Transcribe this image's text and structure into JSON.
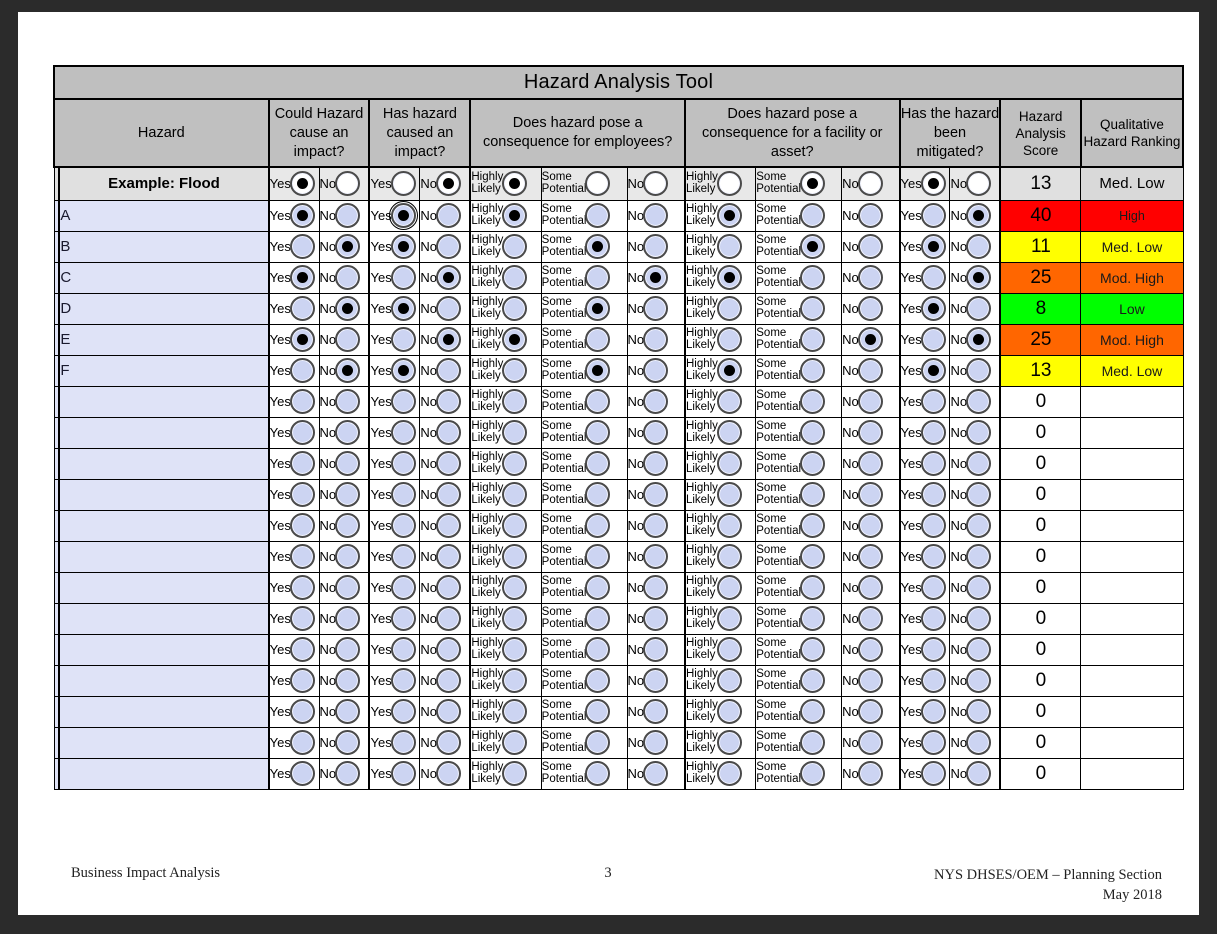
{
  "document": {
    "title": "Hazard Analysis Tool"
  },
  "columns": {
    "hazard": "Hazard",
    "could_cause": "Could Hazard cause an impact?",
    "has_caused": "Has hazard caused an impact?",
    "employees": "Does hazard pose a consequence for employees?",
    "facility": "Does hazard pose a consequence for a facility or asset?",
    "mitigated": "Has the hazard been mitigated?",
    "score": "Hazard Analysis Score",
    "ranking": "Qualitative Hazard Ranking"
  },
  "labels": {
    "yes": "Yes",
    "no": "No",
    "highly_likely": "Highly Likely",
    "some_potential": "Some Potential",
    "no_consequence": "No"
  },
  "colors": {
    "high": "#ff0000",
    "mod_high": "#ff6600",
    "med_low": "#ffff00",
    "low": "#00ff00",
    "header_gray": "#c0c0c0",
    "row_blue": "#dfe3f7",
    "example_gray": "#e0e0e0"
  },
  "rows": [
    {
      "name": "Example: Flood",
      "example": true,
      "could": "yes",
      "caused": "no",
      "employees": "highly",
      "facility": "some",
      "mitigated": "yes",
      "score": "13",
      "ranking": "Med. Low",
      "color": ""
    },
    {
      "name": "A",
      "example": false,
      "could": "yes",
      "caused": "yes",
      "employees": "highly",
      "facility": "highly",
      "mitigated": "no",
      "score": "40",
      "ranking": "High",
      "color": "#ff0000"
    },
    {
      "name": "B",
      "example": false,
      "could": "no",
      "caused": "yes",
      "employees": "some",
      "facility": "some",
      "mitigated": "yes",
      "score": "11",
      "ranking": "Med. Low",
      "color": "#ffff00"
    },
    {
      "name": "C",
      "example": false,
      "could": "yes",
      "caused": "no",
      "employees": "none",
      "facility": "highly",
      "mitigated": "no",
      "score": "25",
      "ranking": "Mod. High",
      "color": "#ff6600"
    },
    {
      "name": "D",
      "example": false,
      "could": "no",
      "caused": "yes",
      "employees": "some",
      "facility": "",
      "mitigated": "yes",
      "score": "8",
      "ranking": "Low",
      "color": "#00ff00"
    },
    {
      "name": "E",
      "example": false,
      "could": "yes",
      "caused": "no",
      "employees": "highly",
      "facility": "none",
      "mitigated": "no",
      "score": "25",
      "ranking": "Mod. High",
      "color": "#ff6600"
    },
    {
      "name": "F",
      "example": false,
      "could": "no",
      "caused": "yes",
      "employees": "some",
      "facility": "highly",
      "mitigated": "yes",
      "score": "13",
      "ranking": "Med. Low",
      "color": "#ffff00"
    },
    {
      "name": "",
      "example": false,
      "could": "",
      "caused": "",
      "employees": "",
      "facility": "",
      "mitigated": "",
      "score": "0",
      "ranking": "",
      "color": ""
    },
    {
      "name": "",
      "example": false,
      "could": "",
      "caused": "",
      "employees": "",
      "facility": "",
      "mitigated": "",
      "score": "0",
      "ranking": "",
      "color": ""
    },
    {
      "name": "",
      "example": false,
      "could": "",
      "caused": "",
      "employees": "",
      "facility": "",
      "mitigated": "",
      "score": "0",
      "ranking": "",
      "color": ""
    },
    {
      "name": "",
      "example": false,
      "could": "",
      "caused": "",
      "employees": "",
      "facility": "",
      "mitigated": "",
      "score": "0",
      "ranking": "",
      "color": ""
    },
    {
      "name": "",
      "example": false,
      "could": "",
      "caused": "",
      "employees": "",
      "facility": "",
      "mitigated": "",
      "score": "0",
      "ranking": "",
      "color": ""
    },
    {
      "name": "",
      "example": false,
      "could": "",
      "caused": "",
      "employees": "",
      "facility": "",
      "mitigated": "",
      "score": "0",
      "ranking": "",
      "color": ""
    },
    {
      "name": "",
      "example": false,
      "could": "",
      "caused": "",
      "employees": "",
      "facility": "",
      "mitigated": "",
      "score": "0",
      "ranking": "",
      "color": ""
    },
    {
      "name": "",
      "example": false,
      "could": "",
      "caused": "",
      "employees": "",
      "facility": "",
      "mitigated": "",
      "score": "0",
      "ranking": "",
      "color": ""
    },
    {
      "name": "",
      "example": false,
      "could": "",
      "caused": "",
      "employees": "",
      "facility": "",
      "mitigated": "",
      "score": "0",
      "ranking": "",
      "color": ""
    },
    {
      "name": "",
      "example": false,
      "could": "",
      "caused": "",
      "employees": "",
      "facility": "",
      "mitigated": "",
      "score": "0",
      "ranking": "",
      "color": ""
    },
    {
      "name": "",
      "example": false,
      "could": "",
      "caused": "",
      "employees": "",
      "facility": "",
      "mitigated": "",
      "score": "0",
      "ranking": "",
      "color": ""
    },
    {
      "name": "",
      "example": false,
      "could": "",
      "caused": "",
      "employees": "",
      "facility": "",
      "mitigated": "",
      "score": "0",
      "ranking": "",
      "color": ""
    },
    {
      "name": "",
      "example": false,
      "could": "",
      "caused": "",
      "employees": "",
      "facility": "",
      "mitigated": "",
      "score": "0",
      "ranking": "",
      "color": ""
    }
  ],
  "footer": {
    "left": "Business Impact Analysis",
    "page": "3",
    "right_line1": "NYS DHSES/OEM – Planning Section",
    "right_line2": "May 2018"
  }
}
